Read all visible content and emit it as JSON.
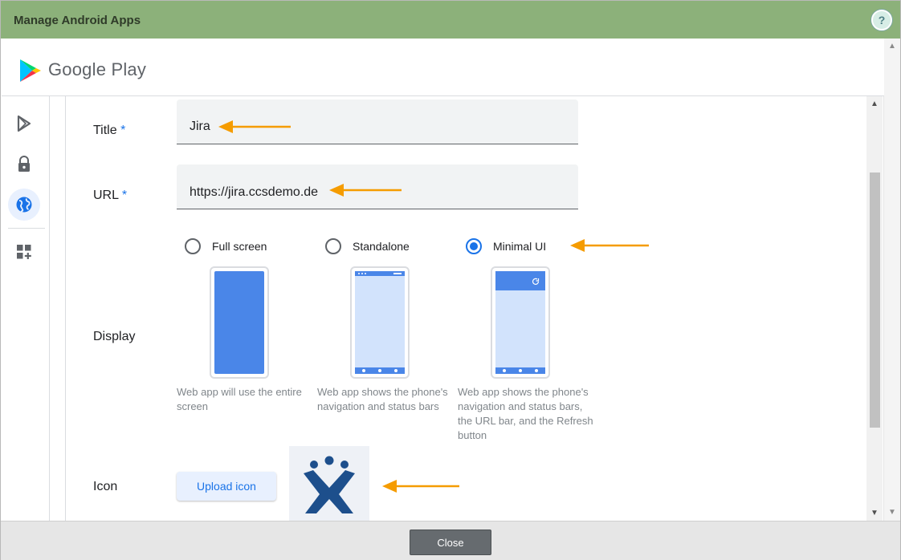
{
  "window": {
    "title": "Manage Android Apps",
    "help_label": "?"
  },
  "header": {
    "brand": "Google Play"
  },
  "sidebar": {
    "items": [
      {
        "icon": "play-store-icon",
        "active": false
      },
      {
        "icon": "lock-icon",
        "active": false
      },
      {
        "icon": "globe-icon",
        "active": true
      },
      {
        "icon": "add-widget-icon",
        "active": false
      }
    ]
  },
  "form": {
    "title": {
      "label": "Title",
      "required_mark": "*",
      "value": "Jira"
    },
    "url": {
      "label": "URL",
      "required_mark": "*",
      "value": "https://jira.ccsdemo.de"
    },
    "display": {
      "label": "Display",
      "options": [
        {
          "label": "Full screen",
          "selected": false,
          "caption": [
            "Web app will use the entire",
            "screen"
          ]
        },
        {
          "label": "Standalone",
          "selected": false,
          "caption": [
            "Web app shows the phone's",
            "navigation and status bars"
          ]
        },
        {
          "label": "Minimal UI",
          "selected": true,
          "caption": [
            "Web app shows the phone's",
            "navigation and status bars,",
            "the URL bar, and the Refresh",
            "button"
          ]
        }
      ]
    },
    "icon": {
      "label": "Icon",
      "upload_label": "Upload icon"
    }
  },
  "footer": {
    "close_label": "Close"
  },
  "colors": {
    "accent": "#1a73e8",
    "titlebar": "#8cb17a",
    "annotation_arrow": "#f59c00",
    "phone_screen": "#4a86e8",
    "phone_screen_light": "#d2e3fc"
  }
}
